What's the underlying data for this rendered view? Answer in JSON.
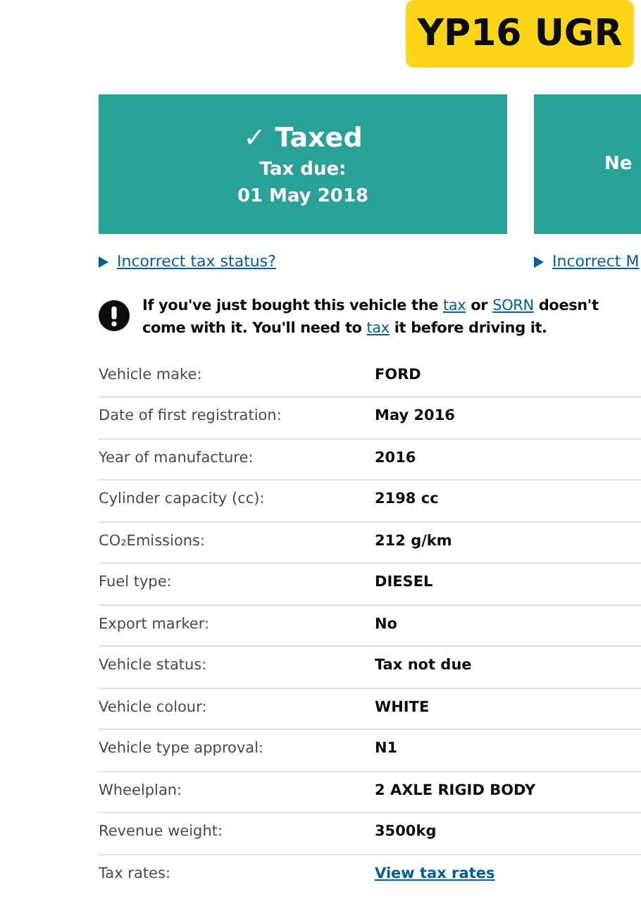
{
  "plate": "YP16 UGR",
  "cards": [
    {
      "heading": "✓ Taxed",
      "lines": [
        "Tax due:",
        "01 May 2018"
      ]
    },
    {
      "lines": [
        "Ne"
      ]
    }
  ],
  "links": [
    "Incorrect tax status?",
    "Incorrect M"
  ],
  "warning": [
    {
      "kind": "text",
      "text": "If you've just bought this vehicle the"
    },
    {
      "kind": "link",
      "text": "tax"
    },
    {
      "kind": "text",
      "text": "or"
    },
    {
      "kind": "link",
      "text": "SORN"
    },
    {
      "kind": "text",
      "text": "doesn't come with it. You'll need to"
    },
    {
      "kind": "link",
      "text": "tax"
    },
    {
      "kind": "text",
      "text": "it before driving it."
    }
  ],
  "details": [
    {
      "label": "Vehicle make:",
      "value": "FORD",
      "kind": "text"
    },
    {
      "label": "Date of first registration:",
      "value": "May 2016",
      "kind": "text"
    },
    {
      "label": "Year of manufacture:",
      "value": "2016",
      "kind": "text"
    },
    {
      "label": "Cylinder capacity (cc):",
      "value": "2198 cc",
      "kind": "text"
    },
    {
      "label": "CO₂Emissions:",
      "value": "212 g/km",
      "kind": "text"
    },
    {
      "label": "Fuel type:",
      "value": "DIESEL",
      "kind": "text"
    },
    {
      "label": "Export marker:",
      "value": "No",
      "kind": "text"
    },
    {
      "label": "Vehicle status:",
      "value": "Tax not due",
      "kind": "text"
    },
    {
      "label": "Vehicle colour:",
      "value": "WHITE",
      "kind": "text"
    },
    {
      "label": "Vehicle type approval:",
      "value": "N1",
      "kind": "text"
    },
    {
      "label": "Wheelplan:",
      "value": "2 AXLE RIGID BODY",
      "kind": "text"
    },
    {
      "label": "Revenue weight:",
      "value": "3500kg",
      "kind": "text"
    },
    {
      "label": "Tax rates:",
      "value": "View tax rates",
      "kind": "link"
    }
  ]
}
